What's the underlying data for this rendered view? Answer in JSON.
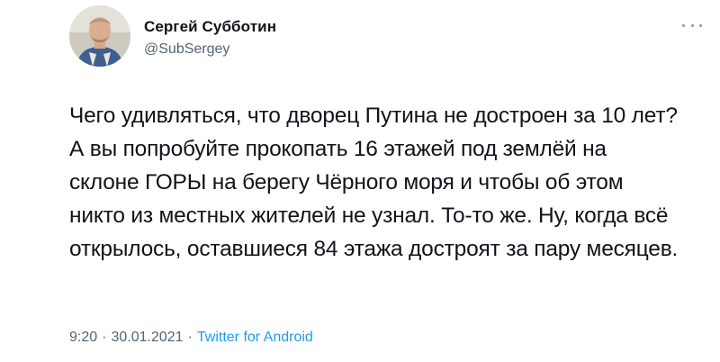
{
  "author": {
    "name": "Сергей Субботин",
    "handle": "@SubSergey"
  },
  "tweet": {
    "text": "Чего удивляться, что дворец Путина не достроен за 10 лет? А вы попробуйте прокопать 16 этажей под землёй на склоне ГОРЫ на берегу Чёрного моря и чтобы об этом никто из местных жителей не узнал. То-то же. Ну, когда всё открылось, оставшиеся 84 этажа достроят за пару месяцев."
  },
  "meta": {
    "time": "9:20",
    "separator": "·",
    "date": "30.01.2021",
    "source": "Twitter for Android"
  },
  "icons": {
    "more": "more-horizontal-icon",
    "avatar": "avatar"
  },
  "colors": {
    "text": "#0f1419",
    "secondary": "#536471",
    "link": "#1d9bf0"
  }
}
